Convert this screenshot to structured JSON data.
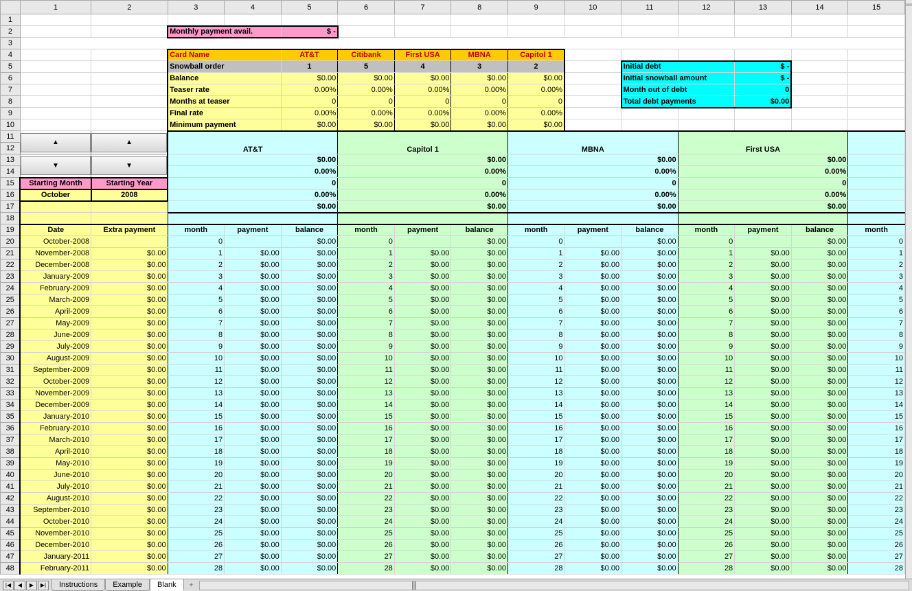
{
  "column_headers": [
    "1",
    "2",
    "3",
    "4",
    "5",
    "6",
    "7",
    "8",
    "9",
    "10",
    "11",
    "12",
    "13",
    "14",
    "15"
  ],
  "row_headers_top": [
    "1",
    "2",
    "3",
    "4",
    "5",
    "6",
    "7",
    "8",
    "9",
    "10",
    "11",
    "12",
    "13",
    "14",
    "15",
    "16",
    "17",
    "18"
  ],
  "row_headers_data": [
    "19",
    "20",
    "21",
    "22",
    "23",
    "24",
    "25",
    "26",
    "27",
    "28",
    "29",
    "30",
    "31",
    "32",
    "33",
    "34",
    "35",
    "36",
    "37",
    "38",
    "39",
    "40",
    "41",
    "42",
    "43",
    "44",
    "45",
    "46",
    "47",
    "48"
  ],
  "monthly_payment_label": "Monthly payment avail.",
  "monthly_payment_value": "$          -",
  "card_row_label": "Card Name",
  "cards": [
    "AT&T",
    "Citibank",
    "First USA",
    "MBNA",
    "Capitol 1"
  ],
  "snowball_label": "Snowball order",
  "snowball_order": [
    "1",
    "5",
    "4",
    "3",
    "2"
  ],
  "balance_label": "Balance",
  "teaser_label": "Teaser rate",
  "months_teaser_label": "Months at teaser",
  "final_rate_label": "Final rate",
  "min_pay_label": "Minimum payment",
  "dollar_zero": "$0.00",
  "pct_zero": "0.00%",
  "int_zero": "0",
  "summary": {
    "initial_debt": "Initial debt",
    "initial_debt_val": "$          -",
    "initial_snowball": "Initial snowball amount",
    "initial_snowball_val": "$          -",
    "month_out": "Month out of debt",
    "month_out_val": "0",
    "total_payments": "Total debt payments",
    "total_payments_val": "$0.00"
  },
  "spinner_up": "▲",
  "spinner_down": "▼",
  "starting_month_label": "Starting Month",
  "starting_year_label": "Starting Year",
  "starting_month": "October",
  "starting_year": "2008",
  "card_blocks": [
    "AT&T",
    "Capitol 1",
    "MBNA",
    "First USA"
  ],
  "date_hdr": "Date",
  "extra_hdr": "Extra payment",
  "m_hdr": "month",
  "p_hdr": "payment",
  "b_hdr": "balance",
  "dates": [
    "October-2008",
    "November-2008",
    "December-2008",
    "January-2009",
    "February-2009",
    "March-2009",
    "April-2009",
    "May-2009",
    "June-2009",
    "July-2009",
    "August-2009",
    "September-2009",
    "October-2009",
    "November-2009",
    "December-2009",
    "January-2010",
    "February-2010",
    "March-2010",
    "April-2010",
    "May-2010",
    "June-2010",
    "July-2010",
    "August-2010",
    "September-2010",
    "October-2010",
    "November-2010",
    "December-2010",
    "January-2011",
    "February-2011"
  ],
  "first_extra": "",
  "tabs": [
    "Instructions",
    "Example",
    "Blank"
  ],
  "active_tab": "Blank",
  "nav_first": "|◀",
  "nav_prev": "◀",
  "nav_next": "▶",
  "nav_last": "▶|"
}
